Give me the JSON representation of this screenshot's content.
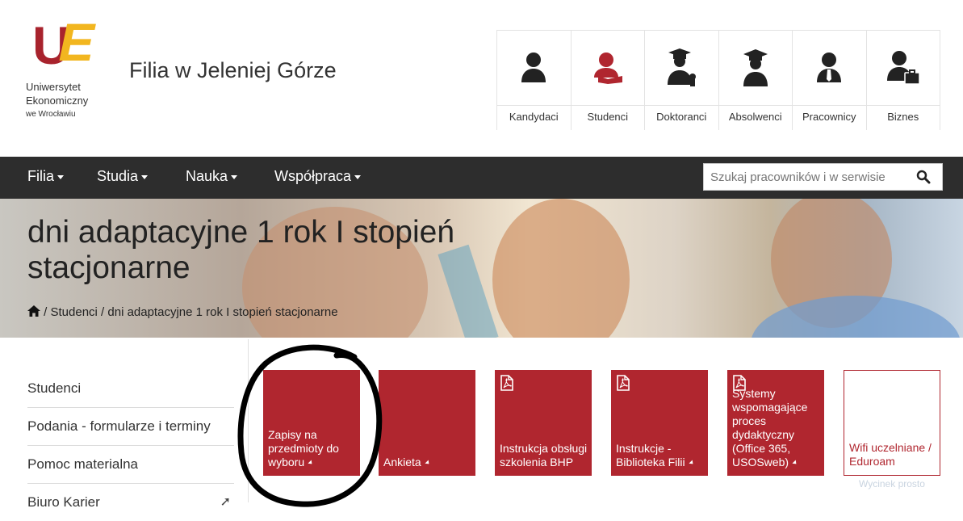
{
  "logo": {
    "line1": "Uniwersytet",
    "line2": "Ekonomiczny",
    "line3": "we Wrocławiu",
    "brand_colors": {
      "u": "#a8232d",
      "e": "#f2b61f"
    }
  },
  "header": {
    "branch_title": "Filia w Jeleniej Górze"
  },
  "roles": [
    {
      "label": "Kandydaci",
      "icon": "user-icon",
      "color": "#222222"
    },
    {
      "label": "Studenci",
      "icon": "student-reading-icon",
      "color": "#b0262f"
    },
    {
      "label": "Doktoranci",
      "icon": "graduate-award-icon",
      "color": "#222222"
    },
    {
      "label": "Absolwenci",
      "icon": "graduate-icon",
      "color": "#222222"
    },
    {
      "label": "Pracownicy",
      "icon": "employee-tie-icon",
      "color": "#222222"
    },
    {
      "label": "Biznes",
      "icon": "business-briefcase-icon",
      "color": "#222222"
    }
  ],
  "nav": {
    "items": [
      "Filia",
      "Studia",
      "Nauka",
      "Współpraca"
    ],
    "search_placeholder": "Szukaj pracowników i w serwisie"
  },
  "hero": {
    "title": "dni adaptacyjne 1 rok I stopień stacjonarne",
    "breadcrumb": "/ Studenci / dni adaptacyjne 1 rok I stopień stacjonarne"
  },
  "sidebar": {
    "items": [
      "Studenci",
      "Podania - formularze i terminy",
      "Pomoc materialna",
      "Biuro Karier"
    ]
  },
  "tiles": [
    {
      "text": "Zapisy na przedmioty do wyboru",
      "pdf": false
    },
    {
      "text": "Ankieta",
      "pdf": false
    },
    {
      "text": "Instrukcja obsługi szkolenia BHP",
      "pdf": true
    },
    {
      "text": "Instrukcje - Biblioteka Filii",
      "pdf": true
    },
    {
      "text": "Systemy wspomagające proces dydaktyczny (Office 365, USOSweb)",
      "pdf": true
    },
    {
      "text": "Wifi uczelniane / Eduroam",
      "pdf": false
    }
  ],
  "overlay": {
    "clip_text": "Wycinek prosto"
  },
  "colors": {
    "accent": "#b0262f",
    "navbar": "#2d2d2d"
  }
}
